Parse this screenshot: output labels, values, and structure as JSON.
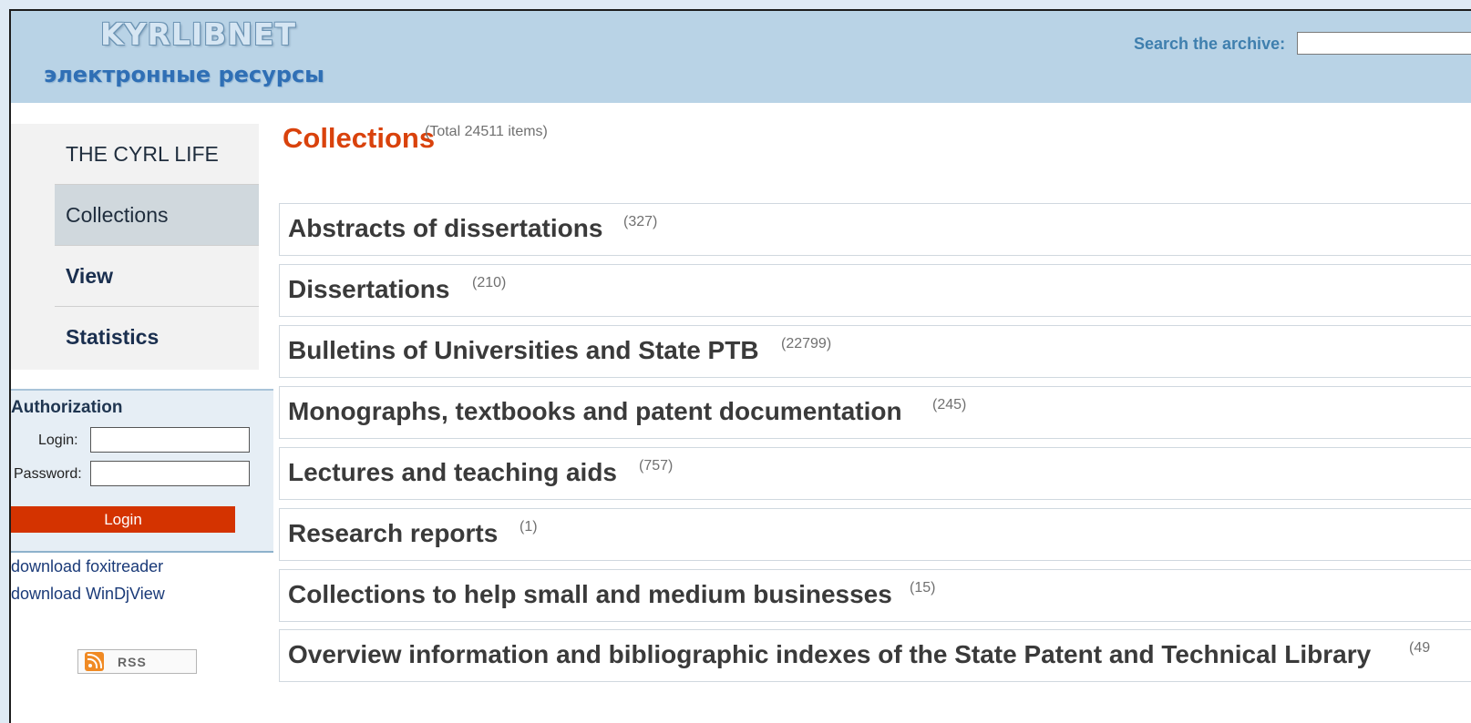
{
  "header": {
    "logo_title": "KYRLIBNET",
    "logo_subtitle": "электронные ресурсы",
    "search_label": "Search the archive:",
    "search_value": ""
  },
  "nav": {
    "items": [
      {
        "label": "THE CYRL LIFE"
      },
      {
        "label": "Collections"
      },
      {
        "label": "View"
      },
      {
        "label": "Statistics"
      }
    ]
  },
  "auth": {
    "title": "Authorization",
    "login_label": "Login:",
    "password_label": "Password:",
    "login_value": "",
    "password_value": "",
    "login_button": "Login"
  },
  "downloads": [
    {
      "label": "download foxitreader"
    },
    {
      "label": "download WinDjView"
    }
  ],
  "rss": {
    "label": "RSS"
  },
  "main": {
    "title": "Collections",
    "total": "(Total 24511 items)",
    "collections": [
      {
        "name": "Abstracts of dissertations",
        "count": "(327)"
      },
      {
        "name": "Dissertations",
        "count": "(210)"
      },
      {
        "name": "Bulletins of Universities and State PTB",
        "count": "(22799)"
      },
      {
        "name": "Monographs, textbooks and patent documentation",
        "count": "(245)"
      },
      {
        "name": "Lectures and teaching aids",
        "count": "(757)"
      },
      {
        "name": "Research reports",
        "count": "(1)"
      },
      {
        "name": "Collections to help small and medium businesses",
        "count": "(15)"
      },
      {
        "name": "Overview information and bibliographic indexes of the State Patent and Technical Library",
        "count": "(49"
      }
    ]
  },
  "colors": {
    "header_bg": "#b9d3e6",
    "accent": "#d9420c",
    "login_button": "#d43300",
    "nav_active": "#d0d8dd"
  }
}
